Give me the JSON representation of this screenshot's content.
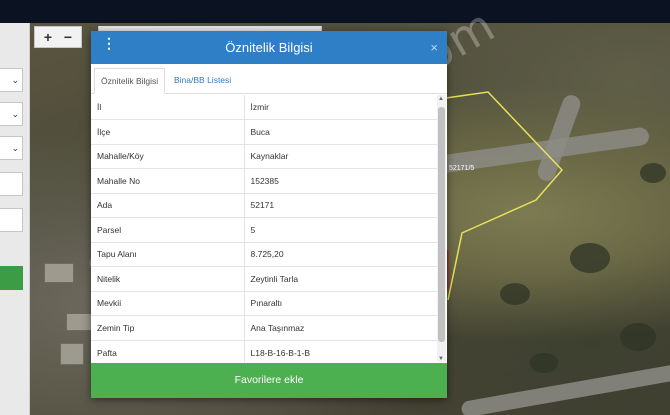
{
  "map": {
    "zoom_in_label": "+",
    "zoom_out_label": "−",
    "parcel_label": "52171/5"
  },
  "side_panel": {
    "select_arrow": "⌄"
  },
  "watermark": "emlakjet.com",
  "modal": {
    "title": "Öznitelik Bilgisi",
    "menu_glyph": "⋮",
    "close_glyph": "×",
    "tabs": [
      {
        "label": "Öznitelik Bilgisi",
        "active": true
      },
      {
        "label": "Bina/BB Listesi",
        "active": false
      }
    ],
    "rows": [
      {
        "key": "İl",
        "value": "İzmir"
      },
      {
        "key": "İlçe",
        "value": "Buca"
      },
      {
        "key": "Mahalle/Köy",
        "value": "Kaynaklar"
      },
      {
        "key": "Mahalle No",
        "value": "152385"
      },
      {
        "key": "Ada",
        "value": "52171"
      },
      {
        "key": "Parsel",
        "value": "5"
      },
      {
        "key": "Tapu Alanı",
        "value": "8.725,20"
      },
      {
        "key": "Nitelik",
        "value": "Zeytinli Tarla"
      },
      {
        "key": "Mevkii",
        "value": "Pınaraltı"
      },
      {
        "key": "Zemin Tip",
        "value": "Ana Taşınmaz"
      },
      {
        "key": "Pafta",
        "value": "L18-B-16-B-1-B"
      }
    ],
    "favorite_button": "Favorilere ekle",
    "scroll_up": "▲",
    "scroll_down": "▼"
  },
  "colors": {
    "header": "#2f7fc6",
    "favorite": "#4caf50",
    "parcel_outline": "#e8e05a"
  }
}
